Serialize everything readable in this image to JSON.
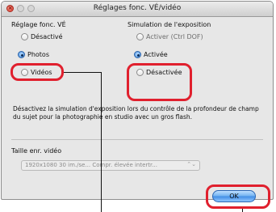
{
  "window": {
    "title": "Réglages fonc. VÉ/vidéo",
    "close_glyph": "×"
  },
  "left_group": {
    "label": "Réglage fonc. VÉ",
    "options": [
      {
        "label": "Désactivé",
        "selected": false
      },
      {
        "label": "Photos",
        "selected": true
      },
      {
        "label": "Vidéos",
        "selected": false
      }
    ]
  },
  "right_group": {
    "label": "Simulation de l'exposition",
    "options": [
      {
        "label": "Activer (Ctrl DOF)",
        "selected": false,
        "disabled": true
      },
      {
        "label": "Activée",
        "selected": true,
        "disabled": false
      },
      {
        "label": "Désactivée",
        "selected": false,
        "disabled": false
      }
    ]
  },
  "description": "Désactivez la simulation d'exposition lors du contrôle de la profondeur de champ du sujet pour la photographie en studio avec un gros flash.",
  "video_size": {
    "label": "Taille enr. vidéo",
    "value": "1920x1080 30 im./se... Compr. élevée intertr...",
    "arrows": "⌃⌄"
  },
  "ok_button": {
    "label": "OK"
  },
  "colors": {
    "highlight": "#e0202e",
    "accent": "#3f8ce4"
  }
}
